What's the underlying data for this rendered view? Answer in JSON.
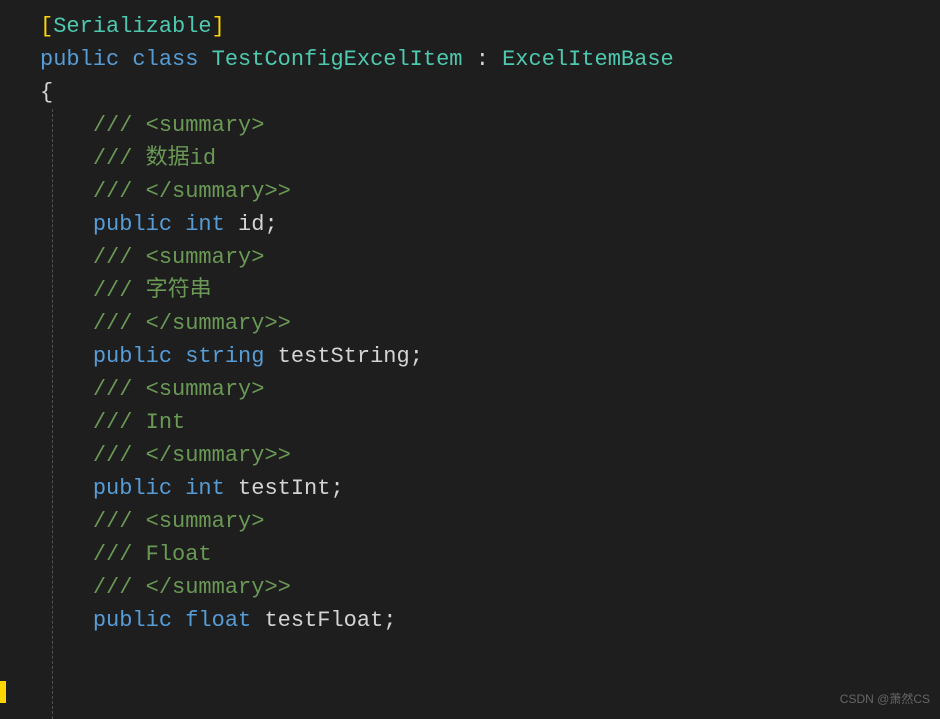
{
  "code": {
    "line1": {
      "bracket_open": "[",
      "attr": "Serializable",
      "bracket_close": "]"
    },
    "line2": {
      "kw_public": "public",
      "kw_class": "class",
      "class_name": "TestConfigExcelItem",
      "colon": ":",
      "base_class": "ExcelItemBase"
    },
    "line3": {
      "brace": "{"
    },
    "line4": {
      "comment": "/// <summary>"
    },
    "line5": {
      "comment": "/// 数据id"
    },
    "line6": {
      "comment": "/// </summary>>"
    },
    "line7": {
      "kw_public": "public",
      "type": "int",
      "name": "id",
      "semi": ";"
    },
    "line8": {
      "comment": "/// <summary>"
    },
    "line9": {
      "comment": "/// 字符串"
    },
    "line10": {
      "comment": "/// </summary>>"
    },
    "line11": {
      "kw_public": "public",
      "type": "string",
      "name": "testString",
      "semi": ";"
    },
    "line12": {
      "comment": "/// <summary>"
    },
    "line13": {
      "comment": "/// Int"
    },
    "line14": {
      "comment": "/// </summary>>"
    },
    "line15": {
      "kw_public": "public",
      "type": "int",
      "name": "testInt",
      "semi": ";"
    },
    "line16": {
      "comment": "/// <summary>"
    },
    "line17": {
      "comment": "/// Float"
    },
    "line18": {
      "comment": "/// </summary>>"
    },
    "line19": {
      "kw_public": "public",
      "type": "float",
      "name": "testFloat",
      "semi": ";"
    }
  },
  "watermark": "CSDN @萧然CS"
}
